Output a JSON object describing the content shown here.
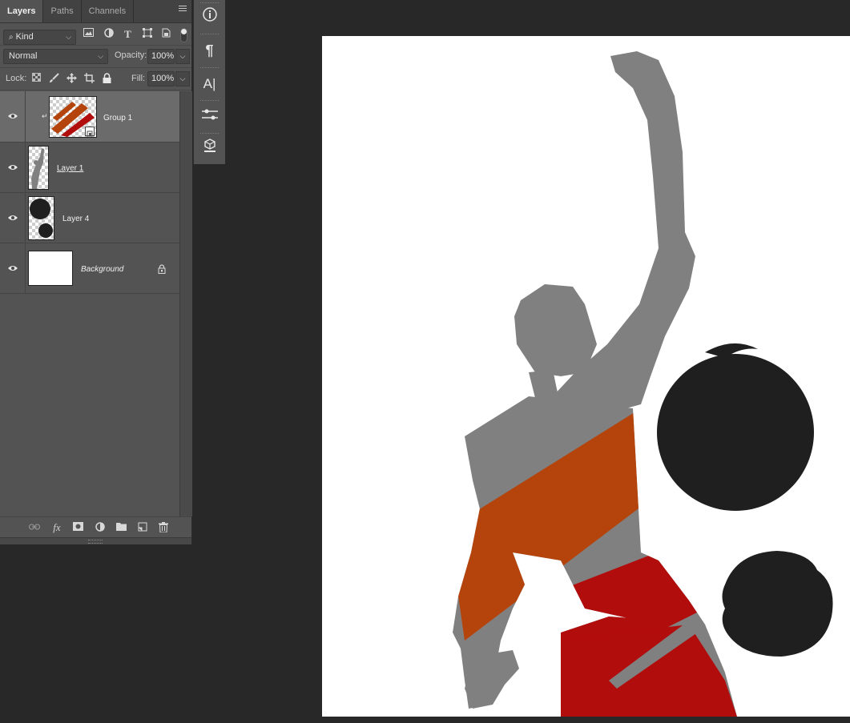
{
  "panel": {
    "tabs": [
      {
        "label": "Layers",
        "active": true
      },
      {
        "label": "Paths",
        "active": false
      },
      {
        "label": "Channels",
        "active": false
      }
    ],
    "menu_icon": "hamburger-menu-icon",
    "filter": {
      "label": "Kind"
    },
    "blend_mode": "Normal",
    "opacity_label": "Opacity:",
    "opacity_value": "100%",
    "lock_label": "Lock:",
    "fill_label": "Fill:",
    "fill_value": "100%"
  },
  "layers": [
    {
      "name": "Group 1",
      "selected": true
    },
    {
      "name": "Layer 1",
      "selected": false
    },
    {
      "name": "Layer 4",
      "selected": false
    },
    {
      "name": "Background",
      "selected": false,
      "locked": true
    }
  ],
  "colors": {
    "panel_bg": "#535353",
    "canvas_bg": "#ffffff",
    "silhouette": "#808080",
    "orange_stripe": "#b4440c",
    "red_stripe": "#b20d0d",
    "ball": "#1f1f1f"
  }
}
